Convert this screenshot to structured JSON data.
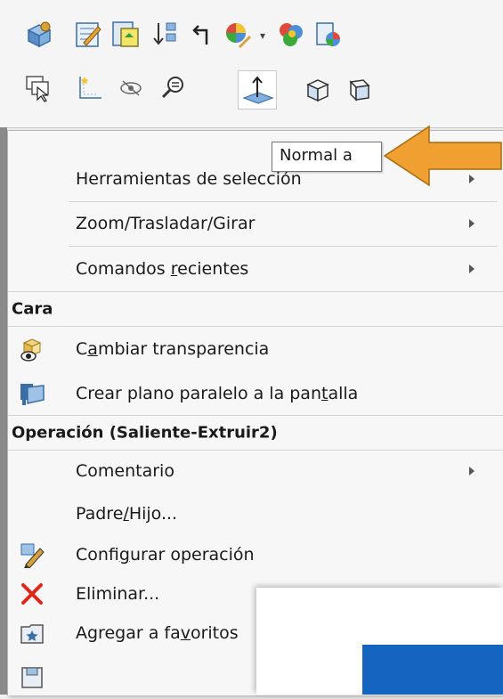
{
  "toolbar": {
    "row1": [
      "rebuild-cube-icon",
      "edit-sketch-icon",
      "edit-document-icon",
      "sort-arrows-icon",
      "back-arrow-icon",
      "appearance-icon",
      "dropdown-arrow-icon",
      "color-spheres-icon",
      "document-color-icon"
    ],
    "row2": [
      "select-cursor-icon",
      "sketch-origin-icon",
      "hide-eye-icon",
      "zoom-selection-icon",
      "normal-to-icon",
      "isometric-cube-icon",
      "front-cube-icon"
    ],
    "selected": "normal-to-icon"
  },
  "tooltip": {
    "text": "Normal a"
  },
  "menu": {
    "items_top": [
      {
        "label": "Herramientas de selección",
        "has_submenu": true
      },
      {
        "label": "Zoom/Trasladar/Girar",
        "has_submenu": true
      },
      {
        "label_pre": "Comandos ",
        "label_acc": "r",
        "label_post": "ecientes",
        "has_submenu": true
      }
    ],
    "section_cara": {
      "title": "Cara"
    },
    "cara_items": [
      {
        "label_pre": "C",
        "label_acc": "a",
        "label_post": "mbiar transparencia",
        "icon": "transparency-icon"
      },
      {
        "label_pre": "Crear plano paralelo a la pan",
        "label_acc": "t",
        "label_post": "alla",
        "icon": "screen-plane-icon"
      }
    ],
    "section_op": {
      "title": "Operación (Saliente-Extruir2)"
    },
    "op_items": [
      {
        "label": "Comentario",
        "has_submenu": true
      },
      {
        "label_pre": "Padre",
        "label_acc": "/",
        "label_post": "Hijo...",
        "has_submenu": false
      },
      {
        "label_pre": "Confi",
        "label_acc": "g",
        "label_post": "urar operación",
        "icon": "edit-feature-icon"
      },
      {
        "label": "Eliminar...",
        "icon": "delete-x-icon"
      },
      {
        "label_pre": "Agregar a fa",
        "label_acc": "v",
        "label_post": "oritos",
        "icon": "favorites-icon"
      }
    ]
  },
  "colors": {
    "accent_orange": "#f0a030",
    "delete_red": "#e0251b",
    "overlay_blue": "#1565c0"
  }
}
